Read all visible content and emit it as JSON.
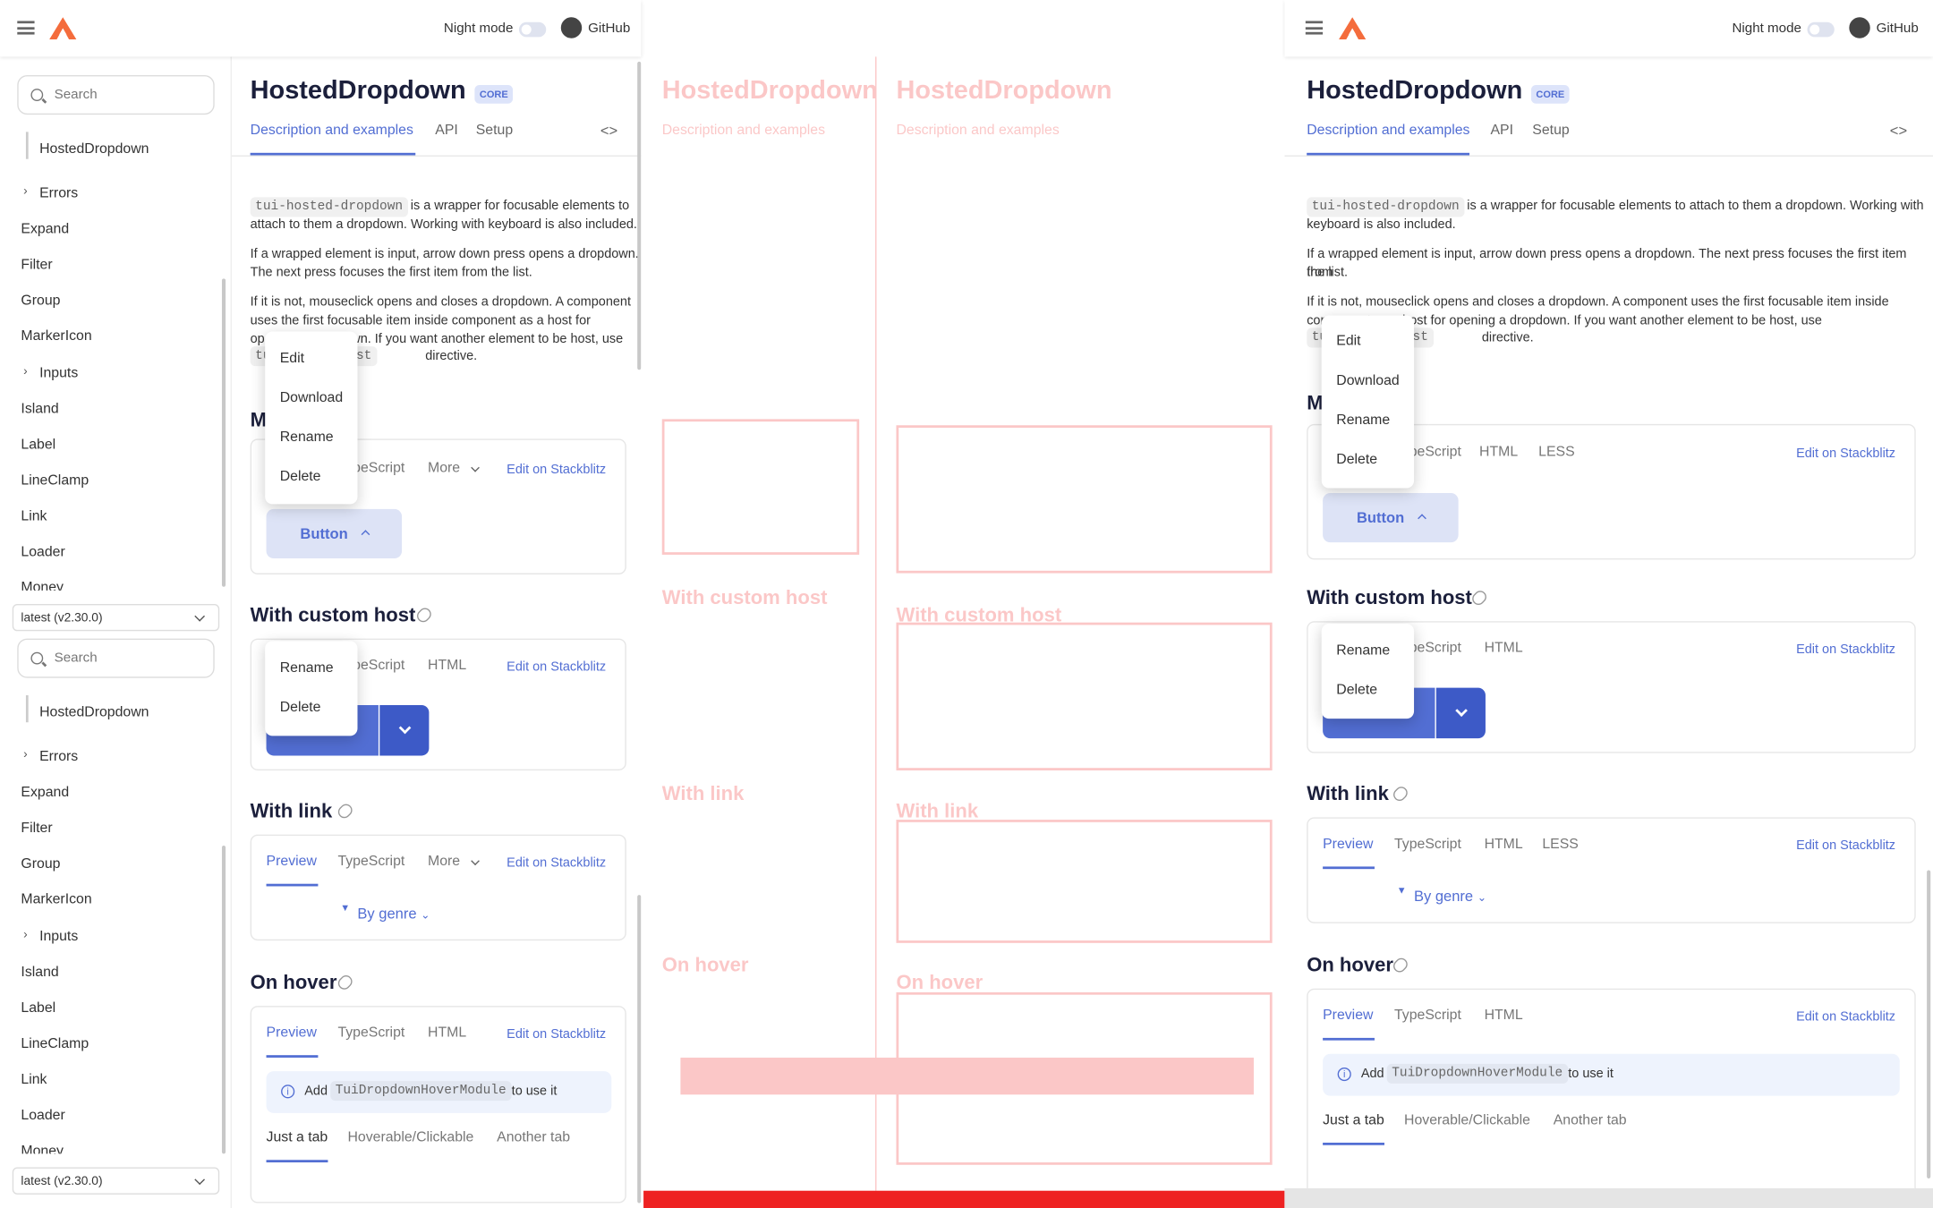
{
  "header": {
    "night_mode": "Night mode",
    "github": "GitHub"
  },
  "sidebar": {
    "search_placeholder": "Search",
    "selected": "HostedDropdown",
    "items": [
      "Errors",
      "Expand",
      "Filter",
      "Group",
      "MarkerIcon",
      "Inputs",
      "Island",
      "Label",
      "LineClamp",
      "Link",
      "Loader",
      "Money"
    ],
    "version": "latest (v2.30.0)"
  },
  "page": {
    "title": "HostedDropdown",
    "badge": "CORE",
    "tabs": [
      "Description and examples",
      "API",
      "Setup"
    ],
    "code_tag": "tui-hosted-dropdown",
    "host_code": "tuiDropdownHost",
    "p1": "is a wrapper for focusable elements to attach to them a dropdown. Working with keyboard is also included.",
    "p1_line1": "is a wrapper for focusable elements to",
    "p1_line2": "attach to them a dropdown. Working with keyboard is also included.",
    "p2_line1": "If a wrapped element is input, arrow down press opens a dropdown.",
    "p2_line2": "The next press focuses the first item from the list.",
    "p3_line1": "If it is not, mouseclick opens and closes a dropdown. A component",
    "p3_line2": "uses the first focusable item inside component as a host for",
    "p3_line3": "opening a dropdown. If you want another element to be host, use",
    "p3_end": "directive.",
    "r_p2_line1": "If a wrapped element is input, arrow down press opens a dropdown. The next press focuses the first item from",
    "r_p2_line2": "the list.",
    "r_p1_line1": "is a wrapper for focusable elements to attach to them a dropdown. Working with",
    "r_p1_line2": "keyboard is also included.",
    "r_p3_line1": "If it is not, mouseclick opens and closes a dropdown. A component uses the first focusable item inside",
    "r_p3_line2": "component as a host for opening a dropdown. If you want another element to be host, use",
    "code_tab_labels": {
      "preview": "Preview",
      "typescript": "TypeScript",
      "html": "HTML",
      "less": "LESS",
      "more": "More",
      "stackblitz": "Edit on Stackblitz"
    },
    "sections": {
      "basic_frag": "M",
      "custom_host": "With custom host",
      "with_link": "With link",
      "on_hover": "On hover"
    },
    "button_label": "Button",
    "dropdown_items": [
      "Edit",
      "Download",
      "Rename",
      "Delete"
    ],
    "dropdown2_items": [
      "Rename",
      "Delete"
    ],
    "by_genre": "By genre",
    "hover_info_pre": "Add",
    "hover_module": "TuiDropdownHoverModule",
    "hover_info_post": "to use it",
    "hover_tabs": [
      "Just a tab",
      "Hoverable/Clickable",
      "Another tab"
    ]
  }
}
